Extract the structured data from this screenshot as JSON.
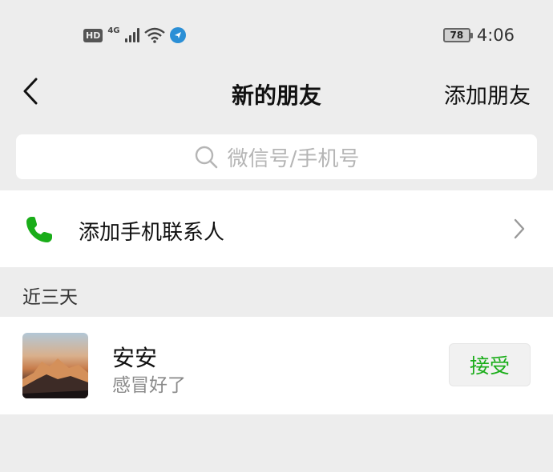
{
  "status_bar": {
    "hd": "HD",
    "network": "4G",
    "battery": "78",
    "time": "4:06"
  },
  "nav": {
    "title": "新的朋友",
    "action": "添加朋友",
    "back_icon": "chevron-left-icon"
  },
  "search": {
    "placeholder": "微信号/手机号",
    "icon": "search-icon"
  },
  "phone_contacts": {
    "label": "添加手机联系人",
    "icon": "phone-icon",
    "icon_color": "#1aad19"
  },
  "section": {
    "title": "近三天"
  },
  "requests": [
    {
      "name": "安安",
      "message": "感冒好了",
      "button": "接受"
    }
  ],
  "colors": {
    "background": "#ededed",
    "accent_green": "#1aad19"
  }
}
